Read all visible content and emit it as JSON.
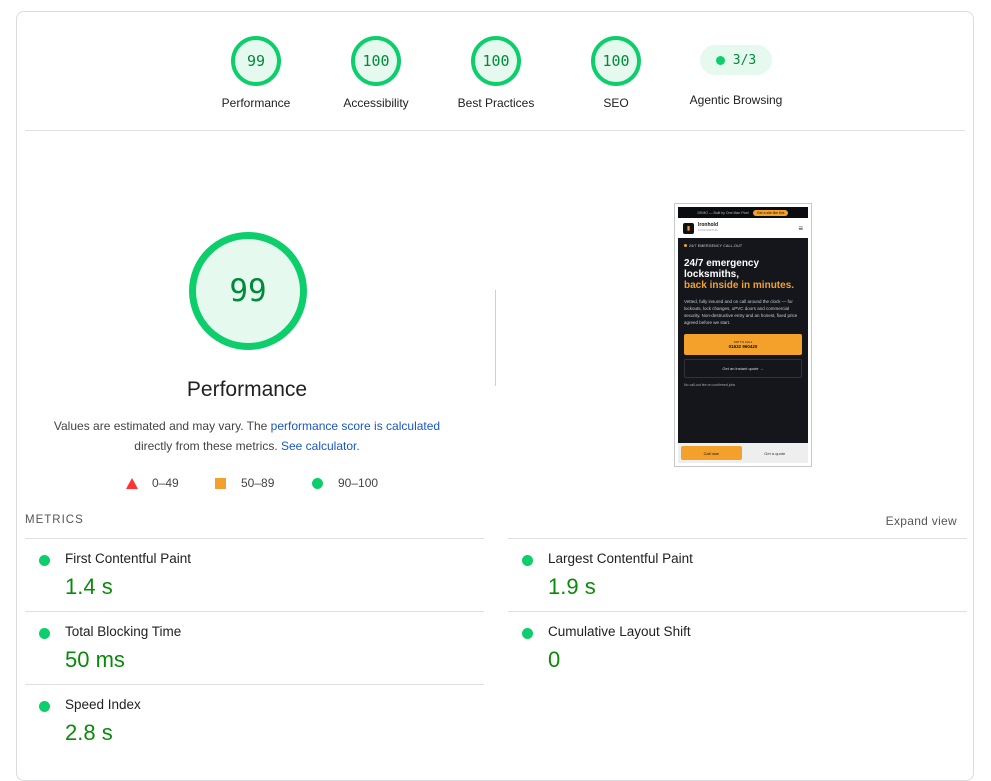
{
  "categories": [
    {
      "score": "99",
      "label": "Performance"
    },
    {
      "score": "100",
      "label": "Accessibility"
    },
    {
      "score": "100",
      "label": "Best Practices"
    },
    {
      "score": "100",
      "label": "SEO"
    }
  ],
  "agentic": {
    "value": "3/3",
    "label": "Agentic Browsing"
  },
  "perf": {
    "score": "99",
    "title": "Performance",
    "desc_prefix": "Values are estimated and may vary. The ",
    "desc_link": "performance score is calculated",
    "desc_middle": "directly from these metrics. ",
    "calc_link": "See calculator.",
    "legend": {
      "fail": "0–49",
      "average": "50–89",
      "pass": "90–100"
    }
  },
  "colors": {
    "pass": "#0cce6b",
    "average": "#f4a02e",
    "fail": "#ff3333",
    "value": "#0a8a0a"
  },
  "preview": {
    "topbar_text": "DEMO — Built by One Man Pixel",
    "topbar_button": "Get a site like this",
    "brand": "Ironhold",
    "brand_sub": "LOCKSMITHS",
    "tag": "24/7 EMERGENCY CALL-OUT",
    "h1_white": "24/7 emergency locksmiths,",
    "h1_orange": "back inside in minutes.",
    "paragraph": "Vetted, fully insured and on call around the clock — for lockouts, lock changes, uPVC doors and commercial security. Non-destructive entry and an honest, fixed price agreed before we start.",
    "call_small": "TAP TO CALL",
    "call_number": "01632 960420",
    "quote": "Get an instant quote →",
    "note": "No call-out fee on confirmed jobs",
    "bottom_call": "Call now",
    "bottom_quote": "Get a quote"
  },
  "metrics": {
    "heading": "METRICS",
    "expand": "Expand view",
    "fcp": {
      "label": "First Contentful Paint",
      "value": "1.4 s"
    },
    "lcp": {
      "label": "Largest Contentful Paint",
      "value": "1.9 s"
    },
    "tbt": {
      "label": "Total Blocking Time",
      "value": "50 ms"
    },
    "cls": {
      "label": "Cumulative Layout Shift",
      "value": "0"
    },
    "si": {
      "label": "Speed Index",
      "value": "2.8 s"
    }
  }
}
